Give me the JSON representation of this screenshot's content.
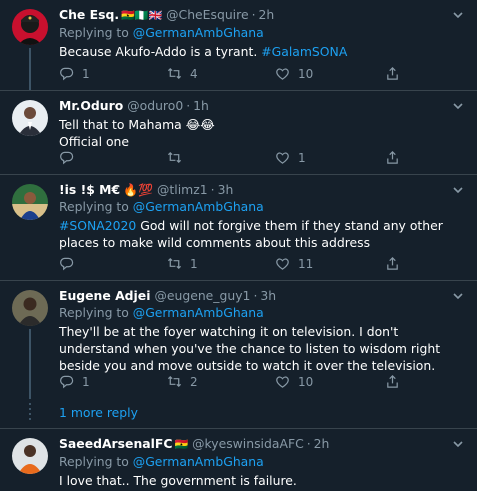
{
  "tweets": [
    {
      "name": "Che Esq.",
      "flags": "🇬🇭🇳🇬🇬🇧",
      "handle": "@CheEsquire",
      "time": "2h",
      "replying_prefix": "Replying to ",
      "replying_to": "@GermanAmbGhana",
      "text_plain": "Because Akufo-Addo is a tyrant. ",
      "text_tag": "#GalamSONA",
      "replies": "1",
      "retweets": "4",
      "likes": "10"
    },
    {
      "name": "Mr.Oduro",
      "handle": "@oduro0",
      "time": "1h",
      "line1": "Tell that to Mahama 😂😂",
      "line2": "Official one",
      "replies": "",
      "retweets": "",
      "likes": "1"
    },
    {
      "name": "!is !$ M€",
      "name_emoji": "🔥💯",
      "handle": "@tlimz1",
      "time": "3h",
      "replying_prefix": "Replying to ",
      "replying_to": "@GermanAmbGhana",
      "text_tag": "#SONA2020",
      "text_plain": " God will not forgive them if they stand any other places to make wild comments about this address",
      "replies": "",
      "retweets": "1",
      "likes": "11"
    },
    {
      "name": "Eugene Adjei",
      "handle": "@eugene_guy1",
      "time": "3h",
      "replying_prefix": "Replying to ",
      "replying_to": "@GermanAmbGhana",
      "text_plain": "They'll be at the foyer watching it on television. I don't understand when you've the chance to listen to wisdom right beside you and move outside to watch it over the television.",
      "replies": "1",
      "retweets": "2",
      "likes": "10"
    },
    {
      "name": "SaeedArsenalFC",
      "flags": "🇬🇭",
      "handle": "@kyeswinsidaAFC",
      "time": "2h",
      "replying_prefix": "Replying to ",
      "replying_to": "@GermanAmbGhana",
      "text_plain": "I love that.. The government is failure."
    }
  ],
  "more_replies": "1 more reply",
  "separator": "·",
  "colors": {
    "background": "#15202b",
    "link": "#1da1f2",
    "muted": "#8899a6",
    "divider": "#38444d"
  },
  "icons": [
    "reply-icon",
    "retweet-icon",
    "like-icon",
    "share-icon",
    "caret-down-icon"
  ]
}
